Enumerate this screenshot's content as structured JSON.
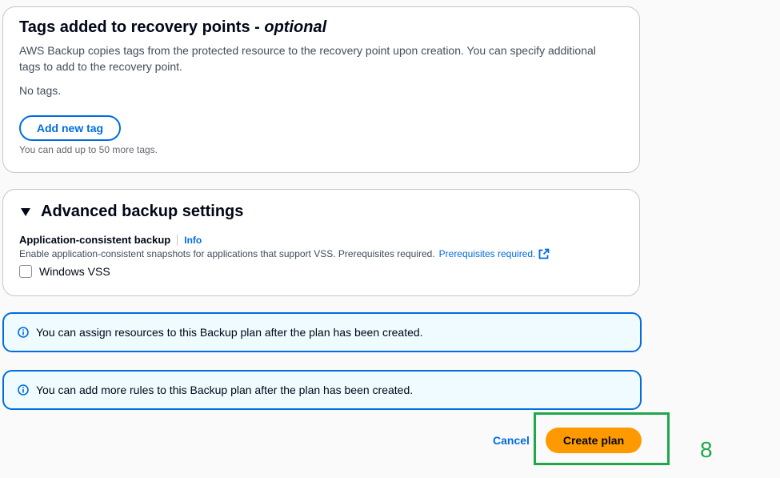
{
  "tags_section": {
    "title": "Tags added to recovery points - ",
    "title_optional": "optional",
    "description": "AWS Backup copies tags from the protected resource to the recovery point upon creation. You can specify additional tags to add to the recovery point.",
    "empty_text": "No tags.",
    "add_button_label": "Add new tag",
    "limit_hint": "You can add up to 50 more tags."
  },
  "advanced_section": {
    "title": "Advanced backup settings",
    "expanded": true,
    "field_label": "Application-consistent backup",
    "info_link": "Info",
    "field_description": "Enable application-consistent snapshots for applications that support VSS. Prerequisites required.",
    "prereq_link": "Prerequisites required.",
    "checkbox_label": "Windows VSS",
    "checkbox_checked": false
  },
  "alerts": [
    {
      "text": "You can assign resources to this Backup plan after the plan has been created."
    },
    {
      "text": "You can add more rules to this Backup plan after the plan has been created."
    }
  ],
  "footer": {
    "cancel_label": "Cancel",
    "create_label": "Create plan"
  },
  "annotation": {
    "step_number": "8",
    "color": "#1fa84a"
  },
  "colors": {
    "primary_button": "#ff9900",
    "link": "#006ce0",
    "alert_bg": "#f0fbff"
  }
}
